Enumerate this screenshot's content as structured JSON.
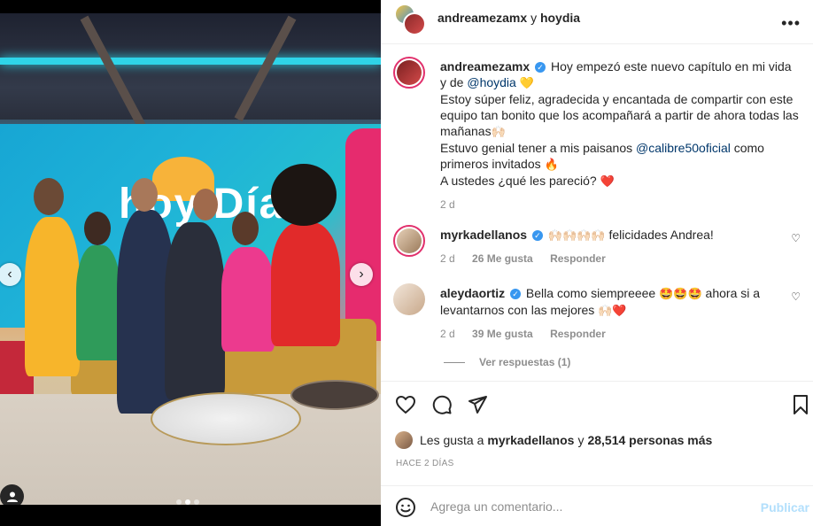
{
  "header": {
    "user_primary": "andreamezamx",
    "connector": "y",
    "user_secondary": "hoydia",
    "more_icon": "more-horizontal-icon"
  },
  "photo": {
    "logo_text": "hoy Día",
    "prev_icon": "chevron-left-icon",
    "next_icon": "chevron-right-icon",
    "tag_icon": "person-tag-icon",
    "carousel_active_index": 1,
    "carousel_count": 3
  },
  "caption": {
    "username": "andreamezamx",
    "line1": "Hoy empezó este nuevo capítulo en mi vida y de ",
    "mention1": "@hoydia",
    "emoji1": "💛",
    "line2": "Estoy súper feliz, agradecida y encantada de compartir con este equipo tan bonito que los acompañará a partir de ahora todas las mañanas",
    "emoji2": "🙌🏻",
    "line3": "Estuvo genial tener a mis paisanos ",
    "mention2": "@calibre50oficial",
    "line3b": " como primeros invitados ",
    "emoji3": "🔥",
    "line4": "A ustedes ¿qué les pareció? ",
    "emoji4": "❤️",
    "time": "2 d"
  },
  "comments": [
    {
      "username": "myrkadellanos",
      "text": " felicidades Andrea!",
      "emoji": "🙌🏻🙌🏻🙌🏻🙌🏻",
      "time": "2 d",
      "likes": "26 Me gusta",
      "reply": "Responder"
    },
    {
      "username": "aleydaortiz",
      "text_before": "Bella como siempreeee ",
      "emoji_a": "🤩🤩🤩",
      "text_after": " ahora si a levantarnos con las mejores ",
      "emoji_b": "🙌🏻❤️",
      "time": "2 d",
      "likes": "39 Me gusta",
      "reply": "Responder"
    }
  ],
  "replies": {
    "label": "Ver respuestas (1)"
  },
  "actions": {
    "like_icon": "heart-icon",
    "comment_icon": "comment-icon",
    "share_icon": "send-icon",
    "save_icon": "bookmark-icon"
  },
  "likes": {
    "prefix": "Les gusta a ",
    "user": "myrkadellanos",
    "middle": " y ",
    "count": "28,514 personas más"
  },
  "time_ago": "HACE 2 DÍAS",
  "add_comment": {
    "placeholder": "Agrega un comentario...",
    "post_label": "Publicar",
    "emoji_icon": "smiley-icon"
  },
  "colors": {
    "verified": "#3897f0",
    "mention": "#00376b",
    "story_ring": "#e1306c",
    "post_button": "#b2dffc"
  }
}
